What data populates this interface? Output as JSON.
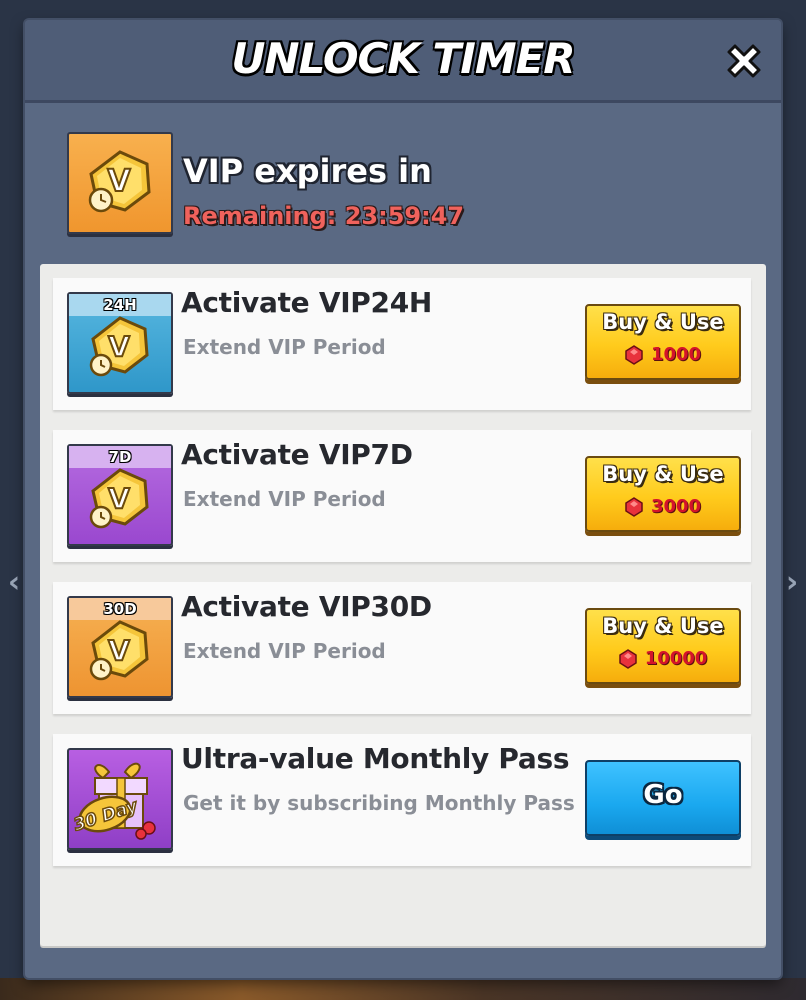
{
  "dialog": {
    "title": "UNLOCK TIMER"
  },
  "status": {
    "headline": "VIP expires in",
    "remaining": "Remaining: 23:59:47"
  },
  "items": [
    {
      "tag": "24H",
      "title": "Activate VIP24H",
      "subtitle": "Extend VIP Period",
      "button": "Buy & Use",
      "price": "1000",
      "tile_color": "#2f97c9",
      "icon": "vip-hexagon-icon"
    },
    {
      "tag": "7D",
      "title": "Activate VIP7D",
      "subtitle": "Extend VIP Period",
      "button": "Buy & Use",
      "price": "3000",
      "tile_color": "#9a48cf",
      "icon": "vip-hexagon-icon"
    },
    {
      "tag": "30D",
      "title": "Activate VIP30D",
      "subtitle": "Extend VIP Period",
      "button": "Buy & Use",
      "price": "10000",
      "tile_color": "#ee9431",
      "icon": "vip-hexagon-icon"
    },
    {
      "title": "Ultra-value Monthly Pass",
      "subtitle": "Get it by subscribing Monthly Pass",
      "button": "Go",
      "tile_color": "#8f3fc6",
      "icon": "gift-box-icon",
      "gift_label": "30 Day"
    }
  ],
  "colors": {
    "accent_gold": "#ffcb1c",
    "accent_blue": "#1aa8ef",
    "remaining_red": "#f0625c",
    "price_red": "#d4142a"
  }
}
